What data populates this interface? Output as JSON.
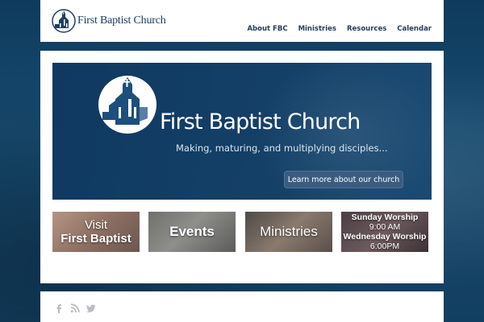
{
  "header": {
    "logo_text": "First Baptist Church",
    "nav": [
      "About FBC",
      "Ministries",
      "Resources",
      "Calendar"
    ]
  },
  "hero": {
    "title": "First Baptist Church",
    "tagline": "Making, maturing, and multiplying disciples...",
    "button_label": "Learn more about our church"
  },
  "tiles": {
    "visit": {
      "line1": "Visit",
      "line2": "First Baptist"
    },
    "events": {
      "label": "Events"
    },
    "ministries": {
      "label": "Ministries"
    },
    "worship": {
      "sunday_label": "Sunday Worship",
      "sunday_time": "9:00 AM",
      "wednesday_label": "Wednesday Worship",
      "wednesday_time": "6:00PM"
    }
  },
  "footer": {
    "social_icons": [
      "facebook-icon",
      "rss-icon",
      "twitter-icon"
    ]
  },
  "colors": {
    "brand_navy": "#1d3e63",
    "hero_blue": "#143f67",
    "page_bg": "#174a6e",
    "social_gray": "#b9bec4"
  }
}
